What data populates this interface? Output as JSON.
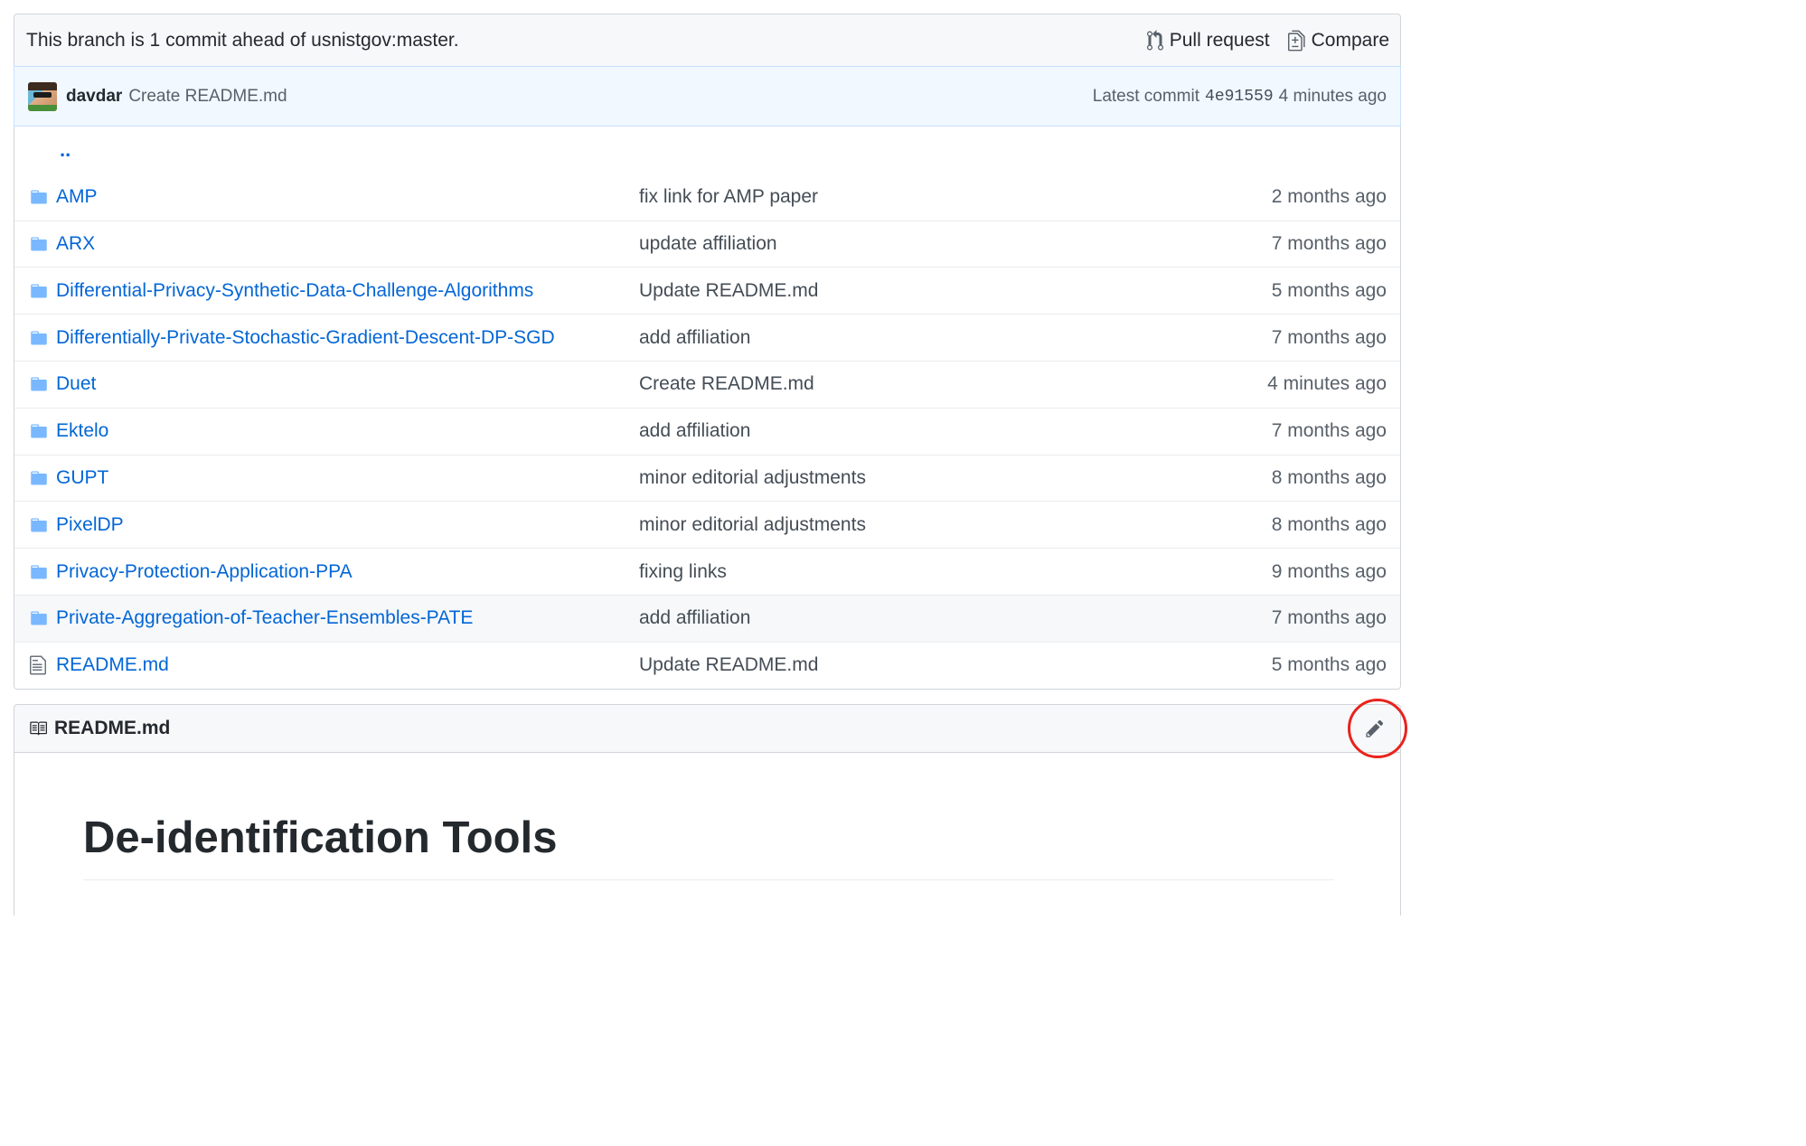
{
  "branch_bar": {
    "message": "This branch is 1 commit ahead of usnistgov:master.",
    "pull_request_label": "Pull request",
    "compare_label": "Compare"
  },
  "latest_commit": {
    "author": "davdar",
    "message": "Create README.md",
    "latest_label": "Latest commit",
    "sha": "4e91559",
    "age": "4 minutes ago"
  },
  "parent_dir": "..",
  "files": [
    {
      "name": "AMP",
      "type": "folder",
      "commit": "fix link for AMP paper",
      "age": "2 months ago"
    },
    {
      "name": "ARX",
      "type": "folder",
      "commit": "update affiliation",
      "age": "7 months ago"
    },
    {
      "name": "Differential-Privacy-Synthetic-Data-Challenge-Algorithms",
      "type": "folder",
      "commit": "Update README.md",
      "age": "5 months ago"
    },
    {
      "name": "Differentially-Private-Stochastic-Gradient-Descent-DP-SGD",
      "type": "folder",
      "commit": "add affiliation",
      "age": "7 months ago"
    },
    {
      "name": "Duet",
      "type": "folder",
      "commit": "Create README.md",
      "age": "4 minutes ago"
    },
    {
      "name": "Ektelo",
      "type": "folder",
      "commit": "add affiliation",
      "age": "7 months ago"
    },
    {
      "name": "GUPT",
      "type": "folder",
      "commit": "minor editorial adjustments",
      "age": "8 months ago"
    },
    {
      "name": "PixelDP",
      "type": "folder",
      "commit": "minor editorial adjustments",
      "age": "8 months ago"
    },
    {
      "name": "Privacy-Protection-Application-PPA",
      "type": "folder",
      "commit": "fixing links",
      "age": "9 months ago"
    },
    {
      "name": "Private-Aggregation-of-Teacher-Ensembles-PATE",
      "type": "folder",
      "commit": "add affiliation",
      "age": "7 months ago"
    },
    {
      "name": "README.md",
      "type": "file",
      "commit": "Update README.md",
      "age": "5 months ago"
    }
  ],
  "readme": {
    "filename": "README.md",
    "heading": "De-identification Tools"
  },
  "colors": {
    "link": "#0366d6",
    "folder_icon": "#79b8ff",
    "highlight_circle": "#e8231c"
  }
}
